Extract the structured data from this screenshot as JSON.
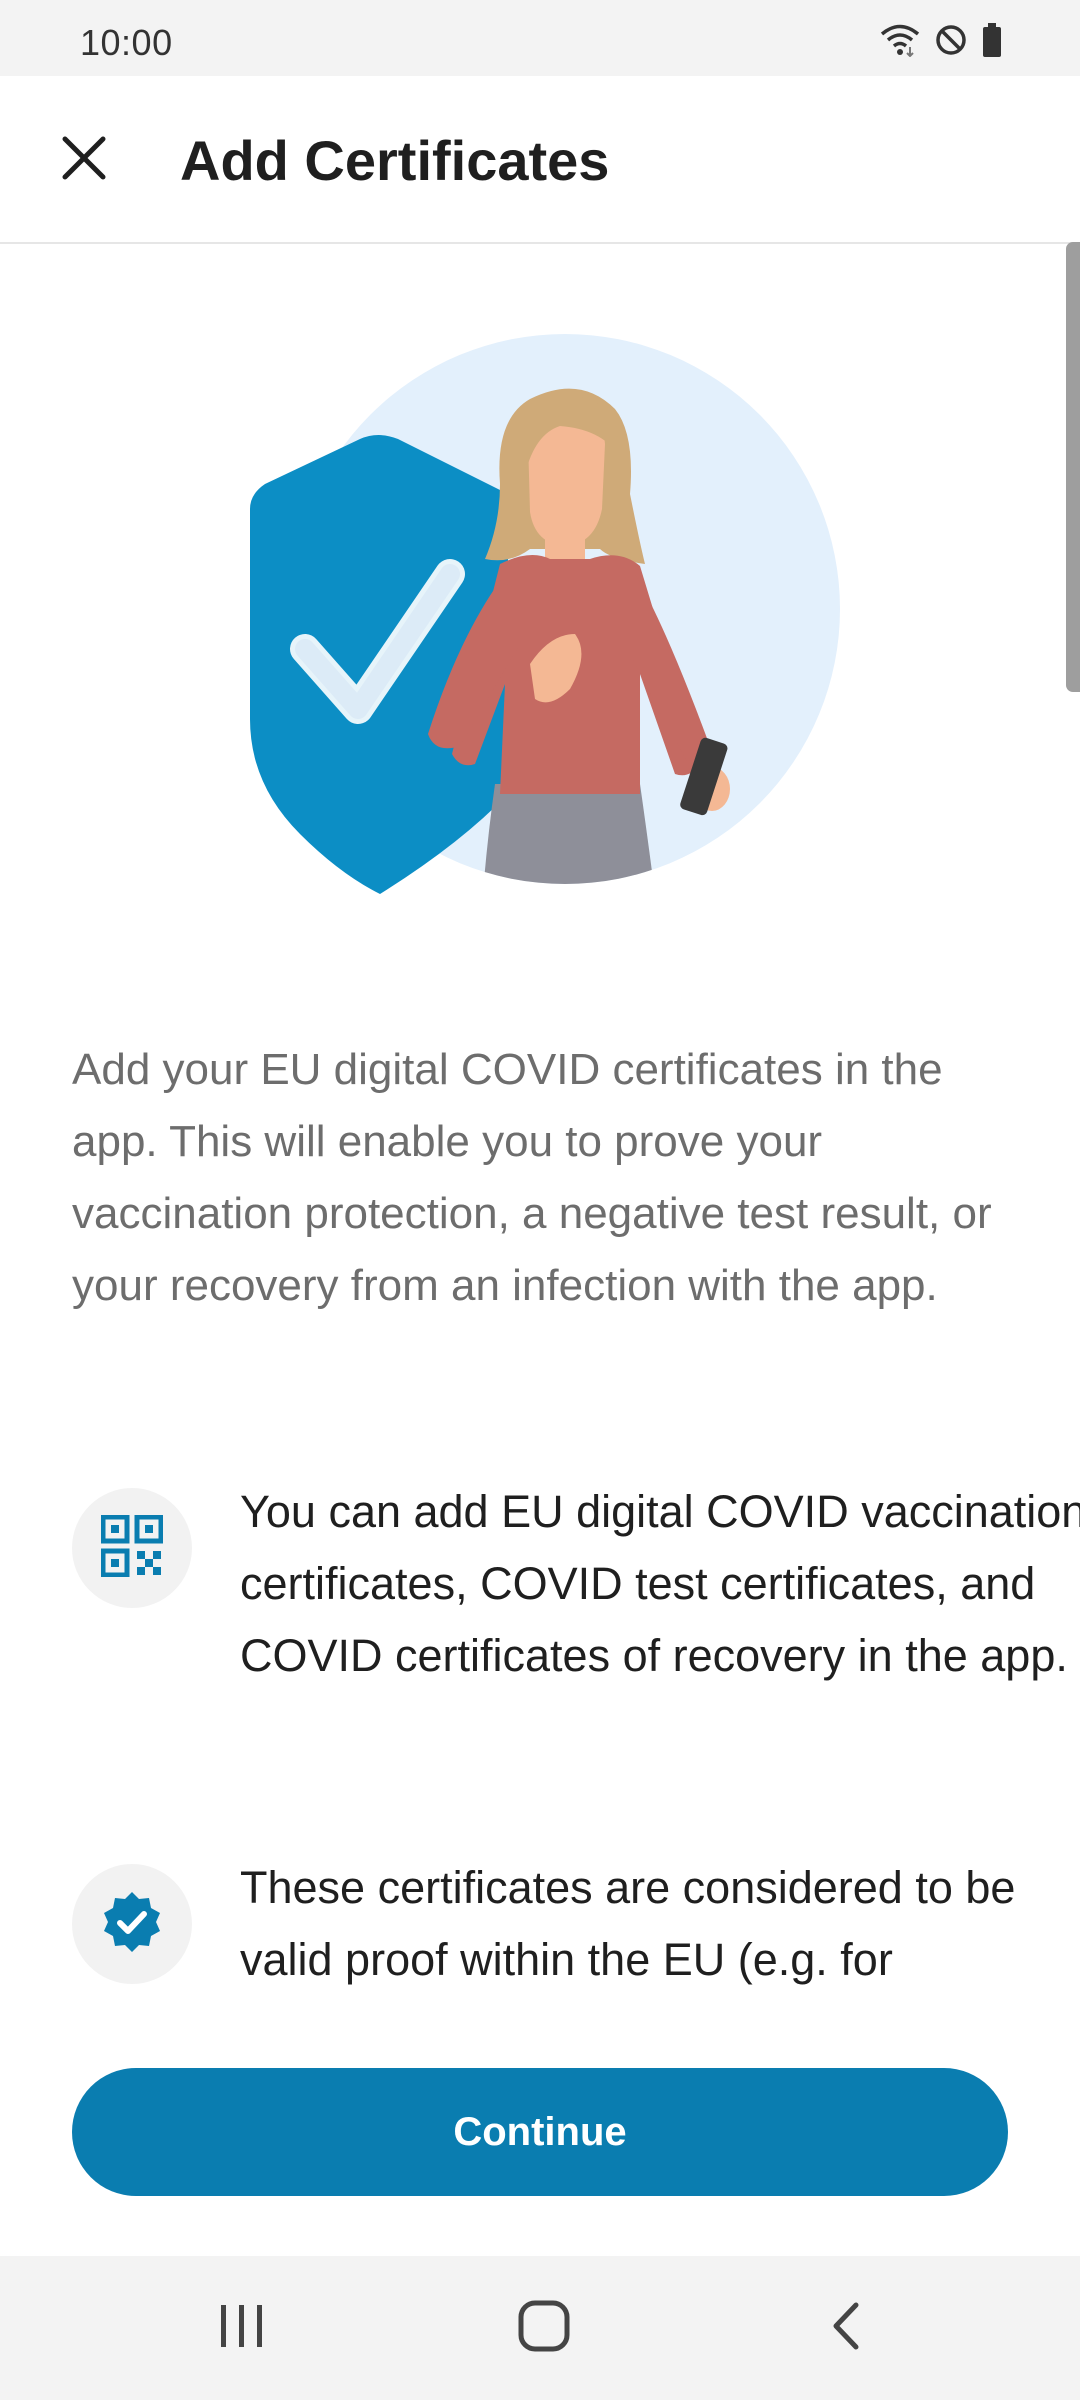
{
  "status_bar": {
    "time": "10:00",
    "icons": [
      "wifi-icon",
      "do-not-disturb-icon",
      "battery-icon"
    ]
  },
  "app_bar": {
    "title": "Add Certificates",
    "close_icon": "close-icon"
  },
  "intro_text": "Add your EU digital COVID certificates in the app. This will enable you to prove your vaccination protection, a negative test result, or your recovery from an infection with the app.",
  "features": [
    {
      "icon": "qr-code-icon",
      "text": "You can add EU digital COVID vaccination certificates, COVID test certificates, and COVID certificates of recovery in the app."
    },
    {
      "icon": "verified-badge-icon",
      "text": "These certificates are considered to be valid proof within the EU (e.g. for"
    }
  ],
  "continue_button": {
    "label": "Continue"
  },
  "nav_bar": {
    "items": [
      "recent-apps-icon",
      "home-icon",
      "back-icon"
    ]
  },
  "colors": {
    "accent": "#0a7db0",
    "shield": "#0c8ec5",
    "illustration_bg": "#e3f0fc",
    "sweater": "#c56a62",
    "hair": "#cfaa78",
    "skin": "#f4b894",
    "skirt": "#8e8f99"
  }
}
